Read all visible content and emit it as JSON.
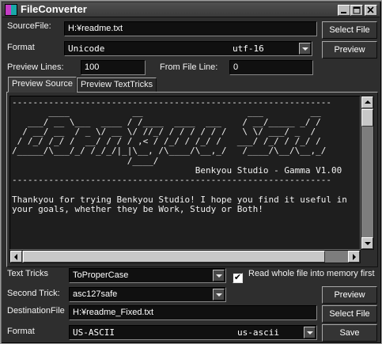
{
  "window": {
    "title": "FileConverter"
  },
  "source": {
    "file_label": "SourceFile:",
    "file_value": "H:¥readme.txt",
    "select_button": "Select File",
    "format_label": "Format",
    "format_name": "Unicode",
    "format_code": "utf-16",
    "preview_button": "Preview",
    "preview_lines_label": "Preview Lines:",
    "preview_lines_value": "100",
    "from_line_label": "From File Line:",
    "from_line_value": "0"
  },
  "tabs": [
    {
      "label": "Preview Source",
      "active": true
    },
    {
      "label": "Preview TextTricks",
      "active": false
    }
  ],
  "preview": {
    "lines": [
      "-------------------------------------------------------------",
      "       ____            __                    ___         __",
      "   ___/ __ \\___  ____ / /____  ____  ___    / __/_____ _/ /",
      "  / __/ __  / _ \\/ __ \\/ //_/ / / / / / /   \\ \\/ ___/ _  / ",
      " / /_/ /_/ /  __/ / / / ,< / /_/ / /_/ /   ___/ /_/ / /_/ /",
      "/_____/\\___/_/ /_/_/|_|\\__, /\\____/\\__,_/   /____/\\__/\\__,_/",
      "                      /____/",
      "                                   Benkyou Studio - Gamma V1.00",
      "-------------------------------------------------------------",
      "",
      "Thankyou for trying Benkyou Studio! I hope you find it useful in",
      "your goals, whether they be Work, Study or Both!"
    ]
  },
  "tricks": {
    "text_tricks_label": "Text Tricks",
    "text_tricks_value": "ToProperCase",
    "second_trick_label": "Second Trick:",
    "second_trick_value": "asc127safe",
    "read_whole_label": "Read whole file into memory first",
    "read_whole_checked": true,
    "preview_button": "Preview"
  },
  "destination": {
    "file_label": "DestinationFile",
    "file_value": "H:¥readme_Fixed.txt",
    "select_button": "Select File",
    "format_label": "Format",
    "format_name": "US-ASCII",
    "format_code": "us-ascii",
    "save_button": "Save"
  },
  "icons": {
    "app": "app-icon",
    "minimize": "minimize-icon",
    "maximize": "maximize-icon",
    "close": "close-icon"
  }
}
